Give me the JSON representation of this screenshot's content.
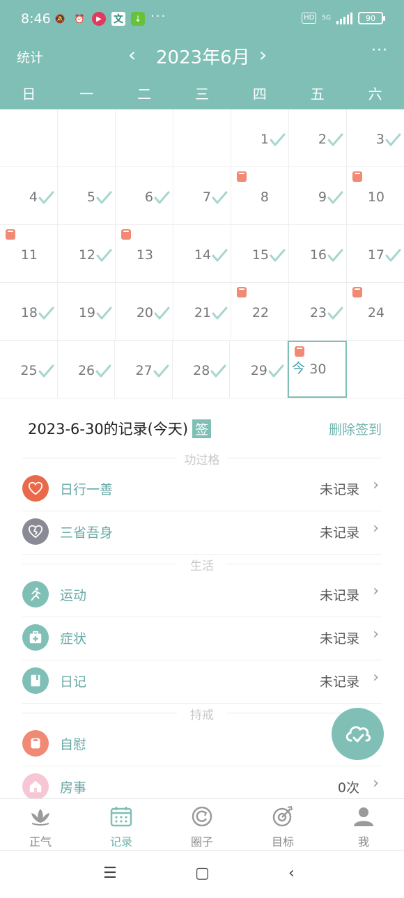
{
  "status_bar": {
    "time": "8:46",
    "battery": "90",
    "network": "5G"
  },
  "header": {
    "stats_label": "统计",
    "month_title": "2023年6月",
    "prev_label": "‹",
    "next_label": "›",
    "more_label": "···"
  },
  "weekdays": [
    "日",
    "一",
    "二",
    "三",
    "四",
    "五",
    "六"
  ],
  "calendar": {
    "rows": [
      [
        {
          "day": "",
          "check": false,
          "pad": false
        },
        {
          "day": "",
          "check": false,
          "pad": false
        },
        {
          "day": "",
          "check": false,
          "pad": false
        },
        {
          "day": "",
          "check": false,
          "pad": false
        },
        {
          "day": "1",
          "check": true,
          "pad": false
        },
        {
          "day": "2",
          "check": true,
          "pad": false
        },
        {
          "day": "3",
          "check": true,
          "pad": false
        }
      ],
      [
        {
          "day": "4",
          "check": true,
          "pad": false
        },
        {
          "day": "5",
          "check": true,
          "pad": false
        },
        {
          "day": "6",
          "check": true,
          "pad": false
        },
        {
          "day": "7",
          "check": true,
          "pad": false
        },
        {
          "day": "8",
          "check": false,
          "pad": true
        },
        {
          "day": "9",
          "check": true,
          "pad": false
        },
        {
          "day": "10",
          "check": false,
          "pad": true
        }
      ],
      [
        {
          "day": "11",
          "check": false,
          "pad": true
        },
        {
          "day": "12",
          "check": true,
          "pad": false
        },
        {
          "day": "13",
          "check": false,
          "pad": true
        },
        {
          "day": "14",
          "check": true,
          "pad": false
        },
        {
          "day": "15",
          "check": true,
          "pad": false
        },
        {
          "day": "16",
          "check": true,
          "pad": false
        },
        {
          "day": "17",
          "check": true,
          "pad": false
        }
      ],
      [
        {
          "day": "18",
          "check": true,
          "pad": false
        },
        {
          "day": "19",
          "check": true,
          "pad": false
        },
        {
          "day": "20",
          "check": true,
          "pad": false
        },
        {
          "day": "21",
          "check": true,
          "pad": false
        },
        {
          "day": "22",
          "check": false,
          "pad": true
        },
        {
          "day": "23",
          "check": true,
          "pad": false
        },
        {
          "day": "24",
          "check": false,
          "pad": true
        }
      ],
      [
        {
          "day": "25",
          "check": true,
          "pad": false
        },
        {
          "day": "26",
          "check": true,
          "pad": false
        },
        {
          "day": "27",
          "check": true,
          "pad": false
        },
        {
          "day": "28",
          "check": true,
          "pad": false
        },
        {
          "day": "29",
          "check": true,
          "pad": false
        },
        {
          "day": "30",
          "check": false,
          "pad": true,
          "today": true
        },
        {
          "day": "",
          "check": false,
          "pad": false
        }
      ]
    ],
    "today_label": "今"
  },
  "record": {
    "title": "2023-6-30的记录(今天)",
    "tag": "签",
    "delete_label": "删除签到",
    "sections": [
      {
        "label": "功过格",
        "items": [
          {
            "name": "日行一善",
            "value": "未记录",
            "icon": "heart-icon",
            "color": "#e96a4a"
          },
          {
            "name": "三省吾身",
            "value": "未记录",
            "icon": "broken-heart-icon",
            "color": "#8a8a94"
          }
        ]
      },
      {
        "label": "生活",
        "items": [
          {
            "name": "运动",
            "value": "未记录",
            "icon": "runner-icon",
            "color": "#7fbfb6"
          },
          {
            "name": "症状",
            "value": "未记录",
            "icon": "medkit-icon",
            "color": "#7fbfb6"
          },
          {
            "name": "日记",
            "value": "未记录",
            "icon": "diary-icon",
            "color": "#7fbfb6"
          }
        ]
      },
      {
        "label": "持戒",
        "items": [
          {
            "name": "自慰",
            "value": "",
            "icon": "tissue-icon",
            "color": "#f08a74"
          },
          {
            "name": "房事",
            "value": "0次",
            "icon": "house-icon",
            "color": "#f7c6d5"
          }
        ]
      }
    ]
  },
  "bottom_nav": [
    {
      "label": "正气",
      "icon": "lotus-icon",
      "active": false
    },
    {
      "label": "记录",
      "icon": "calendar-icon",
      "active": true
    },
    {
      "label": "圈子",
      "icon": "circle-icon",
      "active": false
    },
    {
      "label": "目标",
      "icon": "target-icon",
      "active": false
    },
    {
      "label": "我",
      "icon": "user-icon",
      "active": false
    }
  ],
  "colors": {
    "primary": "#7fbfb6",
    "check": "#a7d6cf",
    "pad": "#f08a74"
  }
}
